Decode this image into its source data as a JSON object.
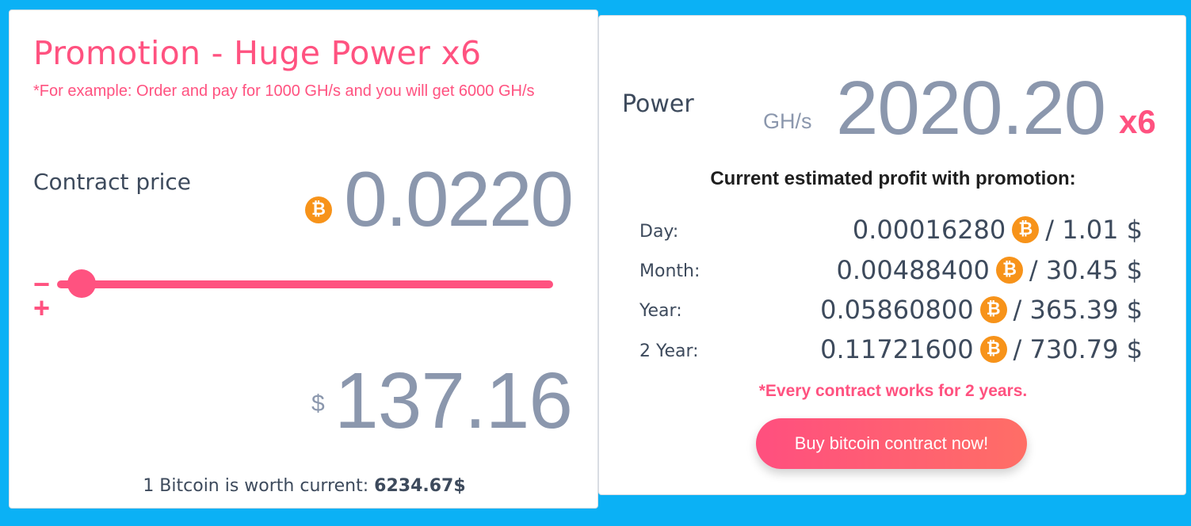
{
  "promo": {
    "title": "Promotion - Huge Power x6",
    "note": "*For example: Order and pay for 1000 GH/s and you will get 6000 GH/s"
  },
  "contract": {
    "label": "Contract price",
    "btc_symbol": "₿",
    "price_btc": "0.0220",
    "slider_minus": "−",
    "slider_plus": "+",
    "slider_position_fraction": 0.05,
    "currency_symbol": "$",
    "price_usd": "137.16"
  },
  "btc_rate": {
    "text": "1 Bitcoin is worth current:",
    "value": "6234.67$"
  },
  "power": {
    "label": "Power",
    "unit": "GH/s",
    "value": "2020.20",
    "multiplier": "x6"
  },
  "profit": {
    "heading": "Current estimated profit with promotion:",
    "rows": [
      {
        "label": "Day:",
        "btc": "0.00016280",
        "usd": "/ 1.01 $"
      },
      {
        "label": "Month:",
        "btc": "0.00488400",
        "usd": "/ 30.45 $"
      },
      {
        "label": "Year:",
        "btc": "0.05860800",
        "usd": "/ 365.39 $"
      },
      {
        "label": "2 Year:",
        "btc": "0.11721600",
        "usd": "/ 730.79 $"
      }
    ]
  },
  "note_years": "*Every contract works for 2 years.",
  "buy_button": "Buy bitcoin contract now!",
  "colors": {
    "background": "#0bb1f5",
    "accent": "#ff5280",
    "muted_value": "#8b97ad",
    "bitcoin": "#f7931a"
  },
  "icons": {
    "coin": "bitcoin-coin-icon"
  }
}
